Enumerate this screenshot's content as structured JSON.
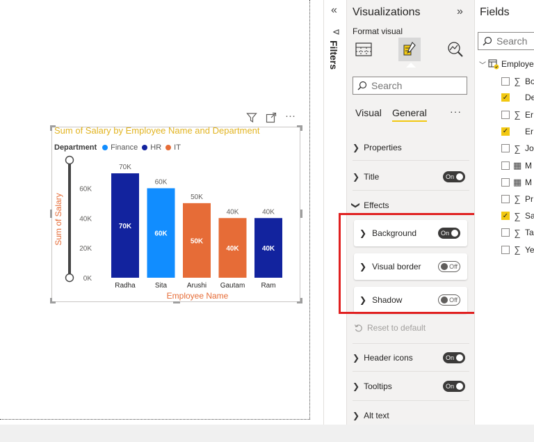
{
  "colors": {
    "finance": "#118DFF",
    "hr": "#12239E",
    "it": "#E66C37",
    "title": "#E2B422",
    "axis_title": "#E66C37",
    "accent": "#F2C811",
    "highlight": "#E02020"
  },
  "visual_header": {
    "filter_icon": "funnel-icon",
    "focus_icon": "focus-mode-icon",
    "more_icon": "more-options-icon",
    "more_label": "···"
  },
  "chart_data": {
    "type": "bar",
    "title": "Sum of Salary by Employee Name and Department",
    "xlabel": "Employee Name",
    "ylabel": "Sum of Salary",
    "categories": [
      "Radha",
      "Sita",
      "Arushi",
      "Gautam",
      "Ram"
    ],
    "values": [
      70000,
      60000,
      50000,
      40000,
      40000
    ],
    "departments": [
      "HR",
      "Finance",
      "IT",
      "IT",
      "HR"
    ],
    "data_labels": [
      "70K",
      "60K",
      "50K",
      "40K",
      "40K"
    ],
    "ylim": [
      0,
      70000
    ],
    "yticks": [
      0,
      20000,
      40000,
      60000
    ],
    "ytick_labels": [
      "0K",
      "20K",
      "40K",
      "60K"
    ],
    "legend_title": "Department",
    "legend": [
      "Finance",
      "HR",
      "IT"
    ],
    "grid": false,
    "legend_placement": "top-left"
  },
  "filters_pane": {
    "label": "Filters",
    "collapse_label": "«",
    "funnel_label": "⊲"
  },
  "viz_pane": {
    "title": "Visualizations",
    "expand_label": "»",
    "format_label": "Format visual",
    "search_placeholder": "Search",
    "tabs": [
      "Visual",
      "General"
    ],
    "more_label": "···",
    "sections": {
      "properties": "Properties",
      "title": "Title",
      "effects": "Effects",
      "background": "Background",
      "visual_border": "Visual border",
      "shadow": "Shadow",
      "reset": "Reset to default",
      "header_icons": "Header icons",
      "tooltips": "Tooltips",
      "alt_text": "Alt text"
    },
    "toggle_on": "On",
    "toggle_off": "Off"
  },
  "fields_pane": {
    "title": "Fields",
    "search_placeholder": "Search",
    "table_name": "Employe",
    "fields": [
      {
        "name": "Bo",
        "checked": false,
        "icon": "sigma-icon",
        "glyph": "∑"
      },
      {
        "name": "De",
        "checked": true,
        "icon": "none",
        "glyph": ""
      },
      {
        "name": "Er",
        "checked": false,
        "icon": "sigma-icon",
        "glyph": "∑"
      },
      {
        "name": "Er",
        "checked": true,
        "icon": "none",
        "glyph": ""
      },
      {
        "name": "Jo",
        "checked": false,
        "icon": "sigma-icon",
        "glyph": "∑"
      },
      {
        "name": "M",
        "checked": false,
        "icon": "calculator-icon",
        "glyph": "▦"
      },
      {
        "name": "M",
        "checked": false,
        "icon": "calculator-icon",
        "glyph": "▦"
      },
      {
        "name": "Pr",
        "checked": false,
        "icon": "sigma-icon",
        "glyph": "∑"
      },
      {
        "name": "Sa",
        "checked": true,
        "icon": "sigma-icon",
        "glyph": "∑"
      },
      {
        "name": "Ta",
        "checked": false,
        "icon": "sigma-icon",
        "glyph": "∑"
      },
      {
        "name": "Ye",
        "checked": false,
        "icon": "sigma-icon",
        "glyph": "∑"
      }
    ]
  }
}
